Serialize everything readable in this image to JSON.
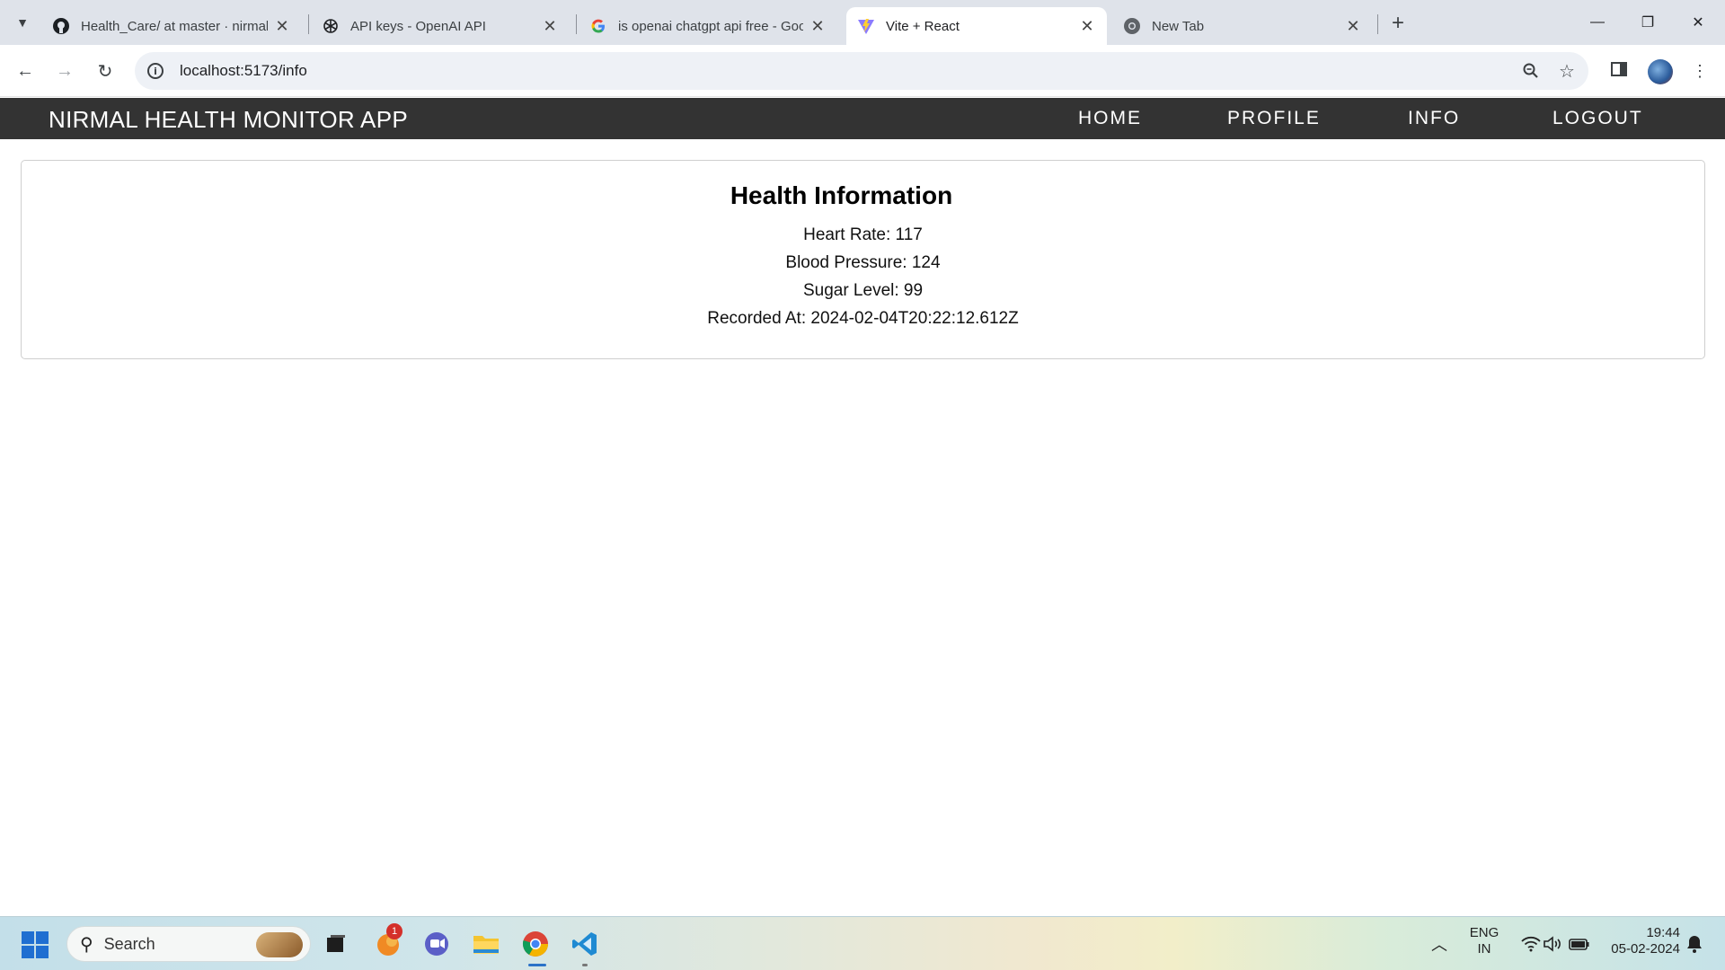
{
  "browser": {
    "tabs": [
      {
        "title": "Health_Care/ at master · nirmalj",
        "favicon": "github-icon"
      },
      {
        "title": "API keys - OpenAI API",
        "favicon": "openai-icon"
      },
      {
        "title": "is openai chatgpt api free - Goo",
        "favicon": "google-icon"
      },
      {
        "title": "Vite + React",
        "favicon": "vite-icon",
        "active": true
      },
      {
        "title": "New Tab",
        "favicon": "chrome-icon"
      }
    ],
    "url": "localhost:5173/info"
  },
  "app": {
    "brand": "NIRMAL HEALTH MONITOR APP",
    "nav": [
      "HOME",
      "PROFILE",
      "INFO",
      "LOGOUT"
    ],
    "header_color": "#333333"
  },
  "health": {
    "title": "Health Information",
    "fields": [
      "Heart Rate: 117",
      "Blood Pressure: 124",
      "Sugar Level: 99",
      "Recorded At: 2024-02-04T20:22:12.612Z"
    ]
  },
  "taskbar": {
    "search_label": "Search",
    "notification_count": "1",
    "lang": "ENG",
    "region": "IN",
    "time": "19:44",
    "date": "05-02-2024"
  }
}
